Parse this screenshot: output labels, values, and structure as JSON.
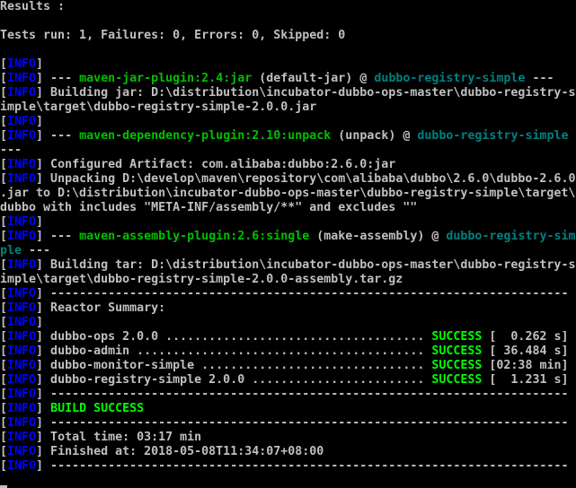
{
  "colors": {
    "background": "#000000",
    "text": "#c0c0c0",
    "info": "#0000ff",
    "plugin": "#00c000",
    "artifact": "#008080",
    "success": "#00ff00"
  },
  "terminal": {
    "results_label": "Results :",
    "tests_summary": "Tests run: 1, Failures: 0, Errors: 0, Skipped: 0",
    "lines": [
      {
        "pre": "",
        "info": "",
        "text": ""
      },
      {
        "pre": "[",
        "info": "INFO",
        "text": "]"
      },
      {
        "pre": "[",
        "info": "INFO",
        "mid": "] --- ",
        "plugin": "maven-jar-plugin:2.4:jar",
        "goal": " (default-jar) @ ",
        "artifact": "dubbo-registry-simple",
        "tail": " ---"
      },
      {
        "pre": "[",
        "info": "INFO",
        "text": "] Building jar: D:\\distribution\\incubator-dubbo-ops-master\\dubbo-registry-s"
      },
      {
        "pre": "",
        "info": "",
        "text": "imple\\target\\dubbo-registry-simple-2.0.0.jar"
      },
      {
        "pre": "[",
        "info": "INFO",
        "text": "]"
      },
      {
        "pre": "[",
        "info": "INFO",
        "mid": "] --- ",
        "plugin": "maven-dependency-plugin:2.10:unpack",
        "goal": " (unpack) @ ",
        "artifact": "dubbo-registry-simple",
        "tail": ""
      },
      {
        "pre": "",
        "info": "",
        "text": "---"
      },
      {
        "pre": "[",
        "info": "INFO",
        "text": "] Configured Artifact: com.alibaba:dubbo:2.6.0:jar"
      },
      {
        "pre": "[",
        "info": "INFO",
        "text": "] Unpacking D:\\develop\\maven\\repository\\com\\alibaba\\dubbo\\2.6.0\\dubbo-2.6.0"
      },
      {
        "pre": "",
        "info": "",
        "text": ".jar to D:\\distribution\\incubator-dubbo-ops-master\\dubbo-registry-simple\\target\\"
      },
      {
        "pre": "",
        "info": "",
        "text": "dubbo with includes \"META-INF/assembly/**\" and excludes \"\""
      },
      {
        "pre": "[",
        "info": "INFO",
        "text": "]"
      },
      {
        "pre": "[",
        "info": "INFO",
        "mid": "] --- ",
        "plugin": "maven-assembly-plugin:2.6:single",
        "goal": " (make-assembly) @ ",
        "artifact": "dubbo-registry-sim",
        "tail": ""
      },
      {
        "pre": "",
        "info": "",
        "artifact2": "ple",
        "text": " ---"
      },
      {
        "pre": "[",
        "info": "INFO",
        "text": "] Building tar: D:\\distribution\\incubator-dubbo-ops-master\\dubbo-registry-s"
      },
      {
        "pre": "",
        "info": "",
        "text": "imple\\target\\dubbo-registry-simple-2.0.0-assembly.tar.gz"
      },
      {
        "pre": "[",
        "info": "INFO",
        "text": "] ------------------------------------------------------------------------"
      },
      {
        "pre": "[",
        "info": "INFO",
        "text": "] Reactor Summary:"
      },
      {
        "pre": "[",
        "info": "INFO",
        "text": "]"
      },
      {
        "pre": "[",
        "info": "INFO",
        "text": "] dubbo-ops 2.0.0 .................................... ",
        "status": "SUCCESS",
        "time": " [  0.262 s]"
      },
      {
        "pre": "[",
        "info": "INFO",
        "text": "] dubbo-admin ........................................ ",
        "status": "SUCCESS",
        "time": " [ 36.484 s]"
      },
      {
        "pre": "[",
        "info": "INFO",
        "text": "] dubbo-monitor-simple ............................... ",
        "status": "SUCCESS",
        "time": " [02:38 min]"
      },
      {
        "pre": "[",
        "info": "INFO",
        "text": "] dubbo-registry-simple 2.0.0 ........................ ",
        "status": "SUCCESS",
        "time": " [  1.231 s]"
      },
      {
        "pre": "[",
        "info": "INFO",
        "text": "] ------------------------------------------------------------------------"
      },
      {
        "pre": "[",
        "info": "INFO",
        "text": "] ",
        "status": "BUILD SUCCESS"
      },
      {
        "pre": "[",
        "info": "INFO",
        "text": "] ------------------------------------------------------------------------"
      },
      {
        "pre": "[",
        "info": "INFO",
        "text": "] Total time: 03:17 min"
      },
      {
        "pre": "[",
        "info": "INFO",
        "text": "] Finished at: 2018-05-08T11:34:07+08:00"
      },
      {
        "pre": "[",
        "info": "INFO",
        "text": "] ------------------------------------------------------------------------"
      }
    ]
  }
}
